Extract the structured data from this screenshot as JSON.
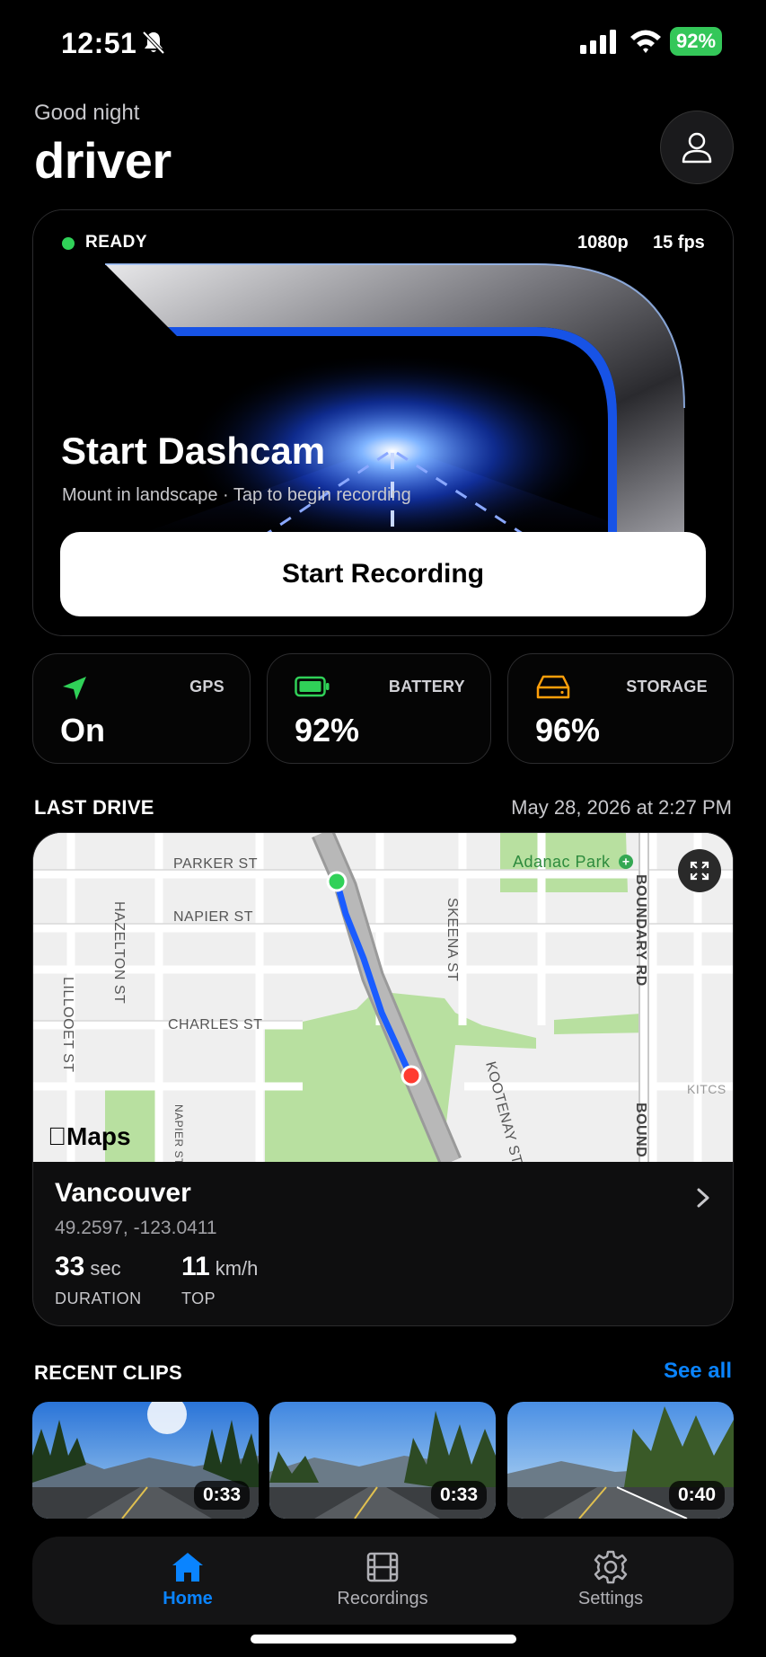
{
  "status_bar": {
    "time": "12:51",
    "battery_percent": "92%"
  },
  "header": {
    "greeting": "Good night",
    "username": "driver"
  },
  "hero": {
    "status": "READY",
    "resolution": "1080p",
    "fps": "15 fps",
    "title": "Start Dashcam",
    "subtitle": "Mount in landscape · Tap to begin recording",
    "button_label": "Start Recording"
  },
  "stats": {
    "gps": {
      "label": "GPS",
      "value": "On",
      "icon": "navigation-arrow-icon",
      "color": "#30d158"
    },
    "battery": {
      "label": "BATTERY",
      "value": "92%",
      "icon": "battery-icon",
      "color": "#30d158"
    },
    "storage": {
      "label": "STORAGE",
      "value": "96%",
      "icon": "drive-icon",
      "color": "#ff9f0a"
    }
  },
  "last_drive": {
    "section_title": "LAST DRIVE",
    "date": "May 28, 2026 at 2:27 PM",
    "map": {
      "streets": [
        "PARKER ST",
        "NAPIER ST",
        "CHARLES ST",
        "HAZELTON ST",
        "LILLOOET ST",
        "SKEENA ST",
        "KOOTENAY ST",
        "BOUNDARY RD",
        "BOUND",
        "KITCS",
        "NAPIER ST"
      ],
      "park": "Adanac Park",
      "attribution": "Maps"
    },
    "city": "Vancouver",
    "coordinates": "49.2597, -123.0411",
    "duration": {
      "value": "33",
      "unit": "sec",
      "label": "DURATION"
    },
    "top_speed": {
      "value": "11",
      "unit": "km/h",
      "label": "TOP"
    }
  },
  "recent_clips": {
    "section_title": "RECENT CLIPS",
    "see_all": "See all",
    "clips": [
      {
        "duration": "0:33"
      },
      {
        "duration": "0:33"
      },
      {
        "duration": "0:40"
      }
    ]
  },
  "tab_bar": {
    "tabs": [
      {
        "label": "Home",
        "icon": "home-icon",
        "active": true
      },
      {
        "label": "Recordings",
        "icon": "film-icon",
        "active": false
      },
      {
        "label": "Settings",
        "icon": "gear-icon",
        "active": false
      }
    ]
  },
  "colors": {
    "accent": "#0a84ff",
    "ready": "#30d158",
    "route": "#1a5cff",
    "start_pin": "#30d158",
    "end_pin": "#ff3b30"
  }
}
